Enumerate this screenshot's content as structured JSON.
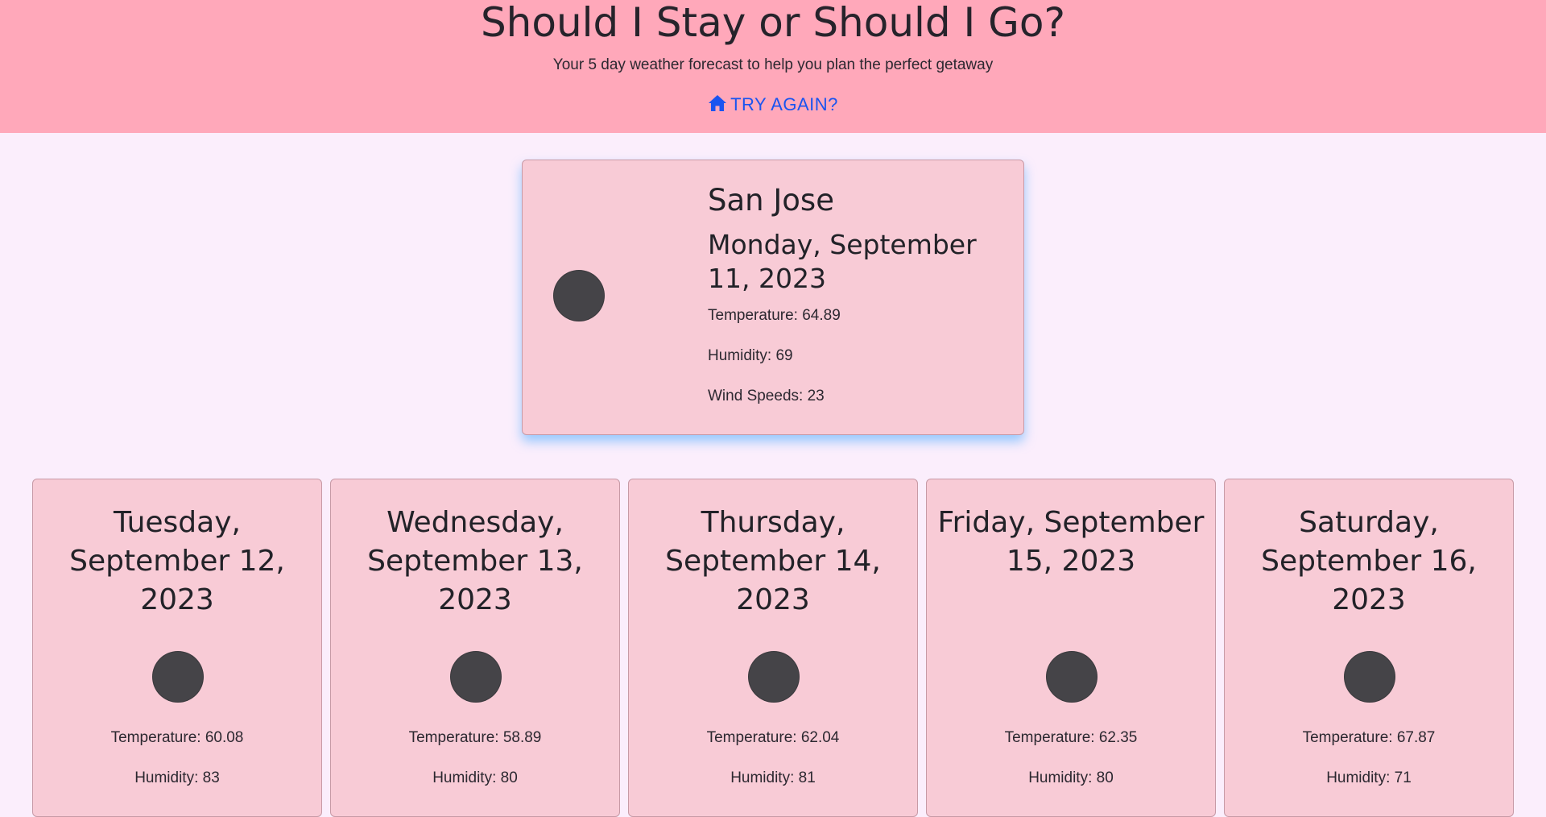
{
  "header": {
    "title": "Should I Stay or Should I Go?",
    "subtitle": "Your 5 day weather forecast to help you plan the perfect getaway",
    "try_again_label": "TRY AGAIN?",
    "try_again_icon": "home-icon",
    "background_color": "#ffa8ba",
    "link_color": "#1a54f0"
  },
  "current": {
    "city": "San Jose",
    "date": "Monday, September 11, 2023",
    "temperature": "Temperature: 64.89",
    "humidity": "Humidity: 69",
    "wind": "Wind Speeds: 23",
    "icon": "weather-icon"
  },
  "forecast": [
    {
      "date": "Tuesday, September 12, 2023",
      "temperature": "Temperature: 60.08",
      "humidity": "Humidity: 83"
    },
    {
      "date": "Wednesday, September 13, 2023",
      "temperature": "Temperature: 58.89",
      "humidity": "Humidity: 80"
    },
    {
      "date": "Thursday, September 14, 2023",
      "temperature": "Temperature: 62.04",
      "humidity": "Humidity: 81"
    },
    {
      "date": "Friday, September 15, 2023",
      "temperature": "Temperature: 62.35",
      "humidity": "Humidity: 80"
    },
    {
      "date": "Saturday, September 16, 2023",
      "temperature": "Temperature: 67.87",
      "humidity": "Humidity: 71"
    }
  ],
  "colors": {
    "page_background": "#fbeefc",
    "card_background": "#f8cbd6",
    "card_glow": "#46aaff",
    "icon_fill": "#454448"
  }
}
